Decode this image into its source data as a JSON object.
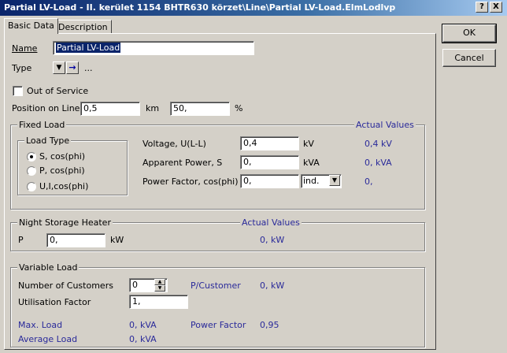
{
  "window": {
    "title": "Partial LV-Load - II. kerület 1154 BHTR630 körzet\\Line\\Partial LV-Load.ElmLodlvp",
    "help_button": "?",
    "close_button": "X"
  },
  "tabs": [
    {
      "label": "Basic Data",
      "active": true
    },
    {
      "label": "Description",
      "active": false
    }
  ],
  "buttons": {
    "ok": "OK",
    "cancel": "Cancel"
  },
  "basic": {
    "name_label": "Name",
    "name_value": "Partial LV-Load",
    "type_label": "Type",
    "type_ellipsis": "...",
    "out_of_service_label": "Out of Service",
    "out_of_service_checked": false,
    "position_label": "Position on Line",
    "position_km_value": "0,5",
    "position_km_unit": "km",
    "position_pct_value": "50,",
    "position_pct_unit": "%"
  },
  "fixed_load": {
    "title": "Fixed Load",
    "actual_values_label": "Actual Values",
    "load_type": {
      "title": "Load Type",
      "options": [
        "S, cos(phi)",
        "P, cos(phi)",
        "U,I,cos(phi)"
      ],
      "selected": 0
    },
    "voltage_label": "Voltage, U(L-L)",
    "voltage_value": "0,4",
    "voltage_unit": "kV",
    "voltage_actual": "0,4 kV",
    "apparent_label": "Apparent Power, S",
    "apparent_value": "0,",
    "apparent_unit": "kVA",
    "apparent_actual": "0, kVA",
    "pf_label": "Power Factor, cos(phi)",
    "pf_value": "0,",
    "pf_select": "ind.",
    "pf_actual": "0,"
  },
  "night_storage": {
    "title": "Night Storage Heater",
    "actual_values_label": "Actual Values",
    "p_label": "P",
    "p_value": "0,",
    "p_unit": "kW",
    "p_actual": "0, kW"
  },
  "variable_load": {
    "title": "Variable Load",
    "customers_label": "Number of Customers",
    "customers_value": "0",
    "p_customer_label": "P/Customer",
    "p_customer_value": "0, kW",
    "utilisation_label": "Utilisation Factor",
    "utilisation_value": "1,",
    "max_load_label": "Max. Load",
    "max_load_value": "0, kVA",
    "power_factor_label": "Power Factor",
    "power_factor_value": "0,95",
    "avg_load_label": "Average Load",
    "avg_load_value": "0, kVA"
  }
}
